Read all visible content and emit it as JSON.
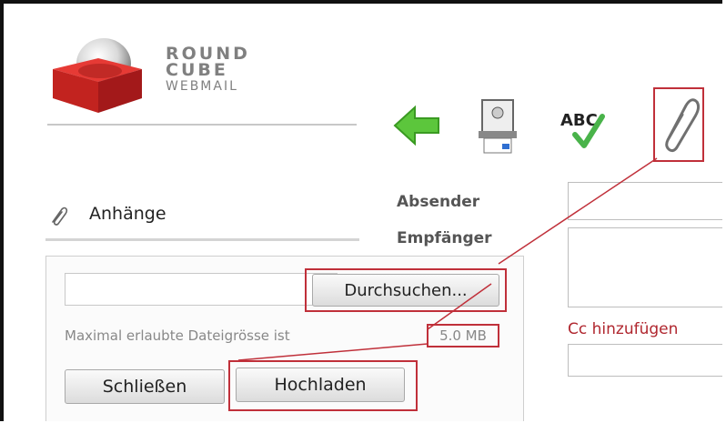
{
  "logo": {
    "line1": "ROUND",
    "line2": "CUBE",
    "line3": "WEBMAIL"
  },
  "toolbar": {
    "icons": [
      "back-arrow-icon",
      "send-icon",
      "spellcheck-icon",
      "attachment-icon"
    ],
    "spell_text": "ABC"
  },
  "attachments": {
    "title": "Anhänge"
  },
  "form": {
    "from_label": "Absender",
    "to_label": "Empfänger",
    "cc_link": "Cc hinzufügen"
  },
  "upload": {
    "browse_label": "Durchsuchen...",
    "max_text": "Maximal erlaubte Dateigrösse ist",
    "max_value": "5.0 MB",
    "close_label": "Schließen",
    "upload_label": "Hochladen"
  },
  "colors": {
    "highlight": "#c0303a",
    "logo_red": "#d42b2b",
    "back_green": "#5cc63c"
  }
}
